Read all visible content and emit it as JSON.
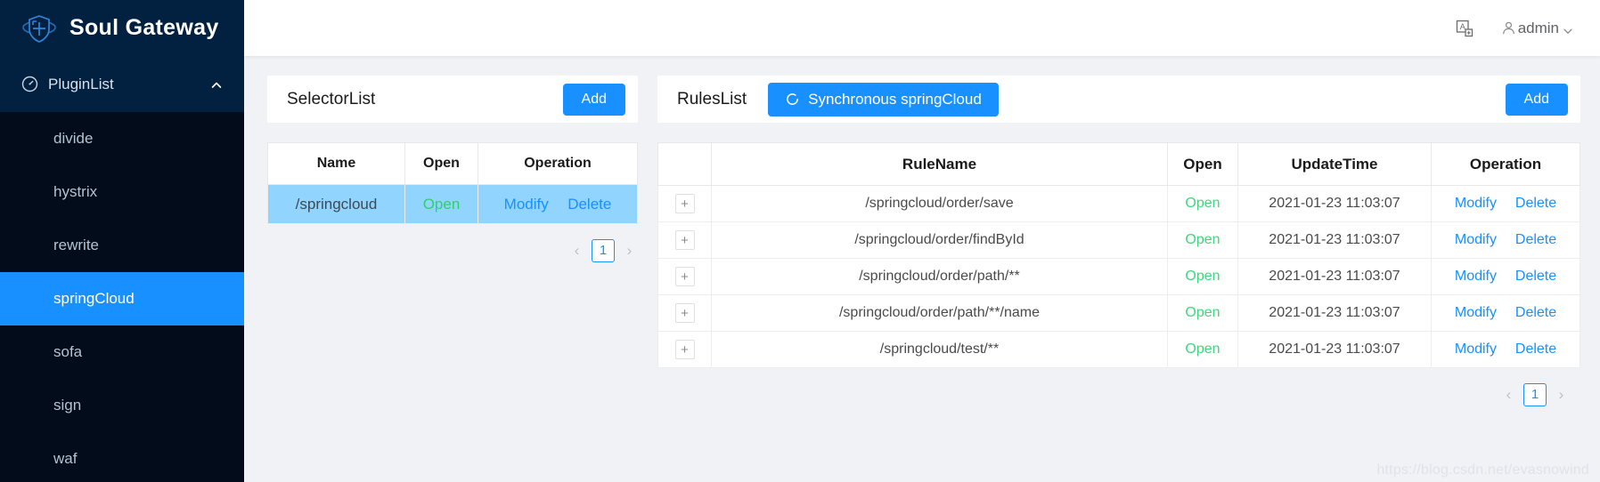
{
  "brand": {
    "name": "Soul Gateway",
    "logo_icon": "shield-globe-logo-icon",
    "logo_color": "#1f6fb8"
  },
  "sidebar": {
    "group": {
      "label": "PluginList",
      "icon": "dashboard-icon",
      "caret_icon": "chevron-up-icon"
    },
    "items": [
      {
        "label": "divide",
        "active": false
      },
      {
        "label": "hystrix",
        "active": false
      },
      {
        "label": "rewrite",
        "active": false
      },
      {
        "label": "springCloud",
        "active": true
      },
      {
        "label": "sofa",
        "active": false
      },
      {
        "label": "sign",
        "active": false
      },
      {
        "label": "waf",
        "active": false
      }
    ]
  },
  "topbar": {
    "language_icon": "translate-language-icon",
    "user_icon": "user-avatar-icon",
    "user_name": "admin",
    "user_caret_icon": "chevron-down-icon"
  },
  "selector_panel": {
    "title": "SelectorList",
    "add_label": "Add",
    "columns": [
      "Name",
      "Open",
      "Operation"
    ],
    "rows": [
      {
        "name": "/springcloud",
        "open": "Open",
        "modify": "Modify",
        "delete": "Delete",
        "selected": true
      }
    ],
    "pagination": {
      "prev_icon": "chevron-left-icon",
      "next_icon": "chevron-right-icon",
      "current": "1"
    }
  },
  "rules_panel": {
    "title": "RulesList",
    "sync_label": "Synchronous springCloud",
    "sync_icon": "refresh-sync-icon",
    "add_label": "Add",
    "columns": [
      "",
      "RuleName",
      "Open",
      "UpdateTime",
      "Operation"
    ],
    "expand_icon": "plus-expand-icon",
    "rows": [
      {
        "expand": "+",
        "rule_name": "/springcloud/order/save",
        "open": "Open",
        "update_time": "2021-01-23 11:03:07",
        "modify": "Modify",
        "delete": "Delete"
      },
      {
        "expand": "+",
        "rule_name": "/springcloud/order/findById",
        "open": "Open",
        "update_time": "2021-01-23 11:03:07",
        "modify": "Modify",
        "delete": "Delete"
      },
      {
        "expand": "+",
        "rule_name": "/springcloud/order/path/**",
        "open": "Open",
        "update_time": "2021-01-23 11:03:07",
        "modify": "Modify",
        "delete": "Delete"
      },
      {
        "expand": "+",
        "rule_name": "/springcloud/order/path/**/name",
        "open": "Open",
        "update_time": "2021-01-23 11:03:07",
        "modify": "Modify",
        "delete": "Delete"
      },
      {
        "expand": "+",
        "rule_name": "/springcloud/test/**",
        "open": "Open",
        "update_time": "2021-01-23 11:03:07",
        "modify": "Modify",
        "delete": "Delete"
      }
    ],
    "pagination": {
      "prev_icon": "chevron-left-icon",
      "next_icon": "chevron-right-icon",
      "current": "1"
    }
  },
  "watermark": "https://blog.csdn.net/evasnowind",
  "colors": {
    "primary": "#1890ff",
    "sidebar_bg": "#020c1b",
    "sidebar_header_bg": "#02203f",
    "selected_row": "#91d5ff",
    "open_green": "#3fd77c",
    "page_bg": "#f0f2f5"
  }
}
